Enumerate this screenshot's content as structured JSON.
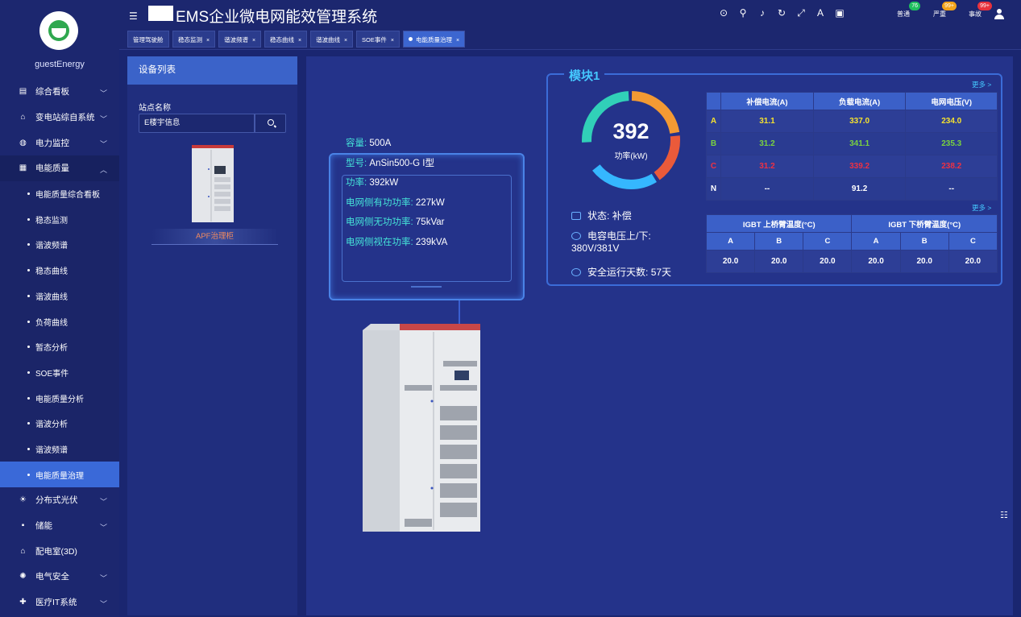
{
  "header": {
    "title": "EMS企业微电网能效管理系统",
    "icons": [
      "help-icon",
      "search-icon",
      "mute-icon",
      "refresh-icon",
      "fullscreen-icon",
      "translate-icon",
      "theme-icon"
    ],
    "alarms": [
      {
        "label": "普通",
        "count": "76",
        "color": "#1fbf5f"
      },
      {
        "label": "严重",
        "count": "99+",
        "color": "#f2a31a"
      },
      {
        "label": "事故",
        "count": "99+",
        "color": "#e8323d"
      }
    ]
  },
  "sidebar": {
    "username": "guestEnergy",
    "items": [
      {
        "label": "综合看板",
        "icon": "dashboard-icon",
        "expandable": true
      },
      {
        "label": "变电站综自系统",
        "icon": "house-icon",
        "expandable": true
      },
      {
        "label": "电力监控",
        "icon": "power-icon",
        "expandable": true
      },
      {
        "label": "电能质量",
        "icon": "quality-icon",
        "expandable": true,
        "open": true
      }
    ],
    "subitems": [
      "电能质量综合看板",
      "稳态监测",
      "谐波频谱",
      "稳态曲线",
      "谐波曲线",
      "负荷曲线",
      "暂态分析",
      "SOE事件",
      "电能质量分析",
      "谐波分析",
      "谐波频谱",
      "电能质量治理"
    ],
    "active_subitem": "电能质量治理",
    "bottom_items": [
      {
        "label": "分布式光伏",
        "icon": "solar-icon",
        "expandable": true
      },
      {
        "label": "储能",
        "icon": "battery-icon",
        "expandable": true
      },
      {
        "label": "配电室(3D)",
        "icon": "home-icon",
        "expandable": false
      },
      {
        "label": "电气安全",
        "icon": "alarm-light-icon",
        "expandable": true
      },
      {
        "label": "医疗IT系统",
        "icon": "medical-icon",
        "expandable": true
      }
    ]
  },
  "tabs": [
    {
      "label": "管理驾驶舱",
      "closable": false
    },
    {
      "label": "稳态监测",
      "closable": true
    },
    {
      "label": "谐波频谱",
      "closable": true
    },
    {
      "label": "稳态曲线",
      "closable": true
    },
    {
      "label": "谐波曲线",
      "closable": true
    },
    {
      "label": "SOE事件",
      "closable": true
    },
    {
      "label": "电能质量治理",
      "closable": true,
      "active": true
    }
  ],
  "device_list": {
    "title": "设备列表",
    "site_label": "站点名称",
    "site_value": "E楼宇信息",
    "device_name": "APF治理柜"
  },
  "device_info": {
    "capacity_label": "容量:",
    "capacity_value": "500A",
    "model_label": "型号:",
    "model_value": "AnSin500-G I型",
    "power_label": "功率:",
    "power_value": "392kW",
    "active_label": "电网侧有功功率:",
    "active_value": "227kW",
    "reactive_label": "电网侧无功功率:",
    "reactive_value": "75kVar",
    "apparent_label": "电网侧视在功率:",
    "apparent_value": "239kVA"
  },
  "module": {
    "title": "模块1",
    "gauge_value": "392",
    "gauge_label": "功率(kW)",
    "status_label": "状态:",
    "status_value": "补偿",
    "voltage_label": "电容电压上/下:",
    "voltage_value": "380V/381V",
    "days_label": "安全运行天数:",
    "days_value": "57天",
    "more1": "更多 >",
    "more2": "更多 >",
    "current_table": {
      "headers": [
        "",
        "补偿电流(A)",
        "负载电流(A)",
        "电网电压(V)"
      ],
      "rows": [
        {
          "phase": "A",
          "values": [
            "31.1",
            "337.0",
            "234.0"
          ],
          "color": "#f5e12f"
        },
        {
          "phase": "B",
          "values": [
            "31.2",
            "341.1",
            "235.3"
          ],
          "color": "#7ad33f"
        },
        {
          "phase": "C",
          "values": [
            "31.2",
            "339.2",
            "238.2"
          ],
          "color": "#ef3143"
        },
        {
          "phase": "N",
          "values": [
            "--",
            "91.2",
            "--"
          ],
          "color": "#ffffff"
        }
      ]
    },
    "temp_table": {
      "group_headers": [
        "IGBT 上桥臂温度(°C)",
        "IGBT 下桥臂温度(°C)"
      ],
      "sub_headers": [
        "A",
        "B",
        "C",
        "A",
        "B",
        "C"
      ],
      "values": [
        "20.0",
        "20.0",
        "20.0",
        "20.0",
        "20.0",
        "20.0"
      ]
    }
  }
}
